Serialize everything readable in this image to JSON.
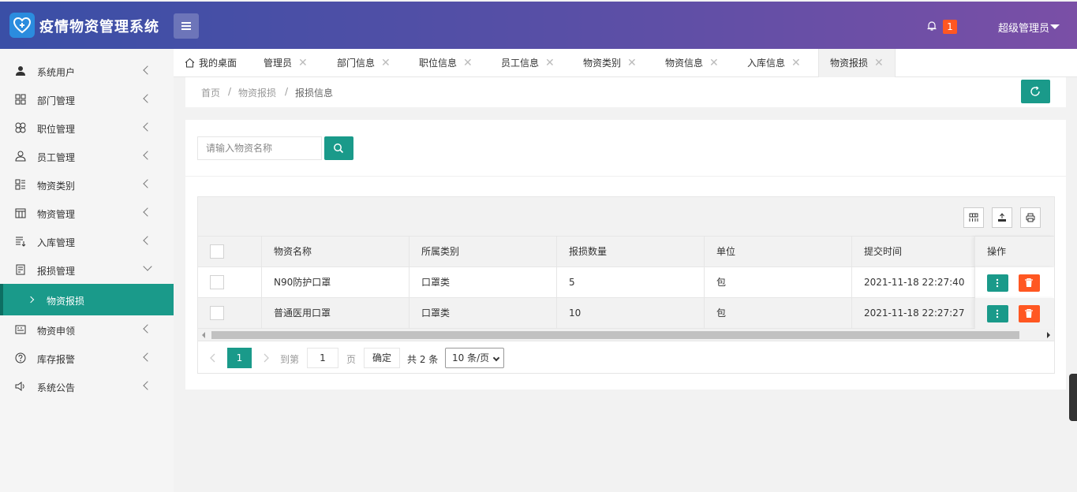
{
  "header": {
    "app_title": "疫情物资管理系统",
    "notification_count": "1",
    "user_name": "超级管理员"
  },
  "sidebar": {
    "items": [
      {
        "label": "系统用户",
        "icon": "user-icon"
      },
      {
        "label": "部门管理",
        "icon": "grid-icon"
      },
      {
        "label": "职位管理",
        "icon": "clover-icon"
      },
      {
        "label": "员工管理",
        "icon": "person-outline-icon"
      },
      {
        "label": "物资类别",
        "icon": "list-grid-icon"
      },
      {
        "label": "物资管理",
        "icon": "calendar-icon"
      },
      {
        "label": "入库管理",
        "icon": "list-icon"
      },
      {
        "label": "报损管理",
        "icon": "document-icon"
      },
      {
        "label": "物资申领",
        "icon": "keyboard-icon"
      },
      {
        "label": "库存报警",
        "icon": "question-circle-icon"
      },
      {
        "label": "系统公告",
        "icon": "speaker-icon"
      }
    ],
    "active_sub": "物资报损"
  },
  "tabs": {
    "home": "我的桌面",
    "items": [
      "管理员",
      "部门信息",
      "职位信息",
      "员工信息",
      "物资类别",
      "物资信息",
      "入库信息",
      "物资报损"
    ]
  },
  "breadcrumb": {
    "items": [
      "首页",
      "物资报损",
      "报损信息"
    ],
    "separator": "/"
  },
  "search": {
    "placeholder": "请输入物资名称"
  },
  "table": {
    "columns": [
      "物资名称",
      "所属类别",
      "报损数量",
      "单位",
      "提交时间",
      "操作"
    ],
    "rows": [
      {
        "name": "N90防护口罩",
        "category": "口罩类",
        "qty": "5",
        "unit": "包",
        "time": "2021-11-18 22:27:40"
      },
      {
        "name": "普通医用口罩",
        "category": "口罩类",
        "qty": "10",
        "unit": "包",
        "time": "2021-11-18 22:27:27"
      }
    ]
  },
  "pager": {
    "current": "1",
    "goto_label": "到第",
    "goto_value": "1",
    "page_label": "页",
    "confirm": "确定",
    "total": "共 2 条",
    "page_size": "10 条/页"
  },
  "colors": {
    "primary": "#1a9a8a",
    "danger": "#ff5722",
    "header_start": "#3a4fa6",
    "header_end": "#7a4fa6"
  }
}
